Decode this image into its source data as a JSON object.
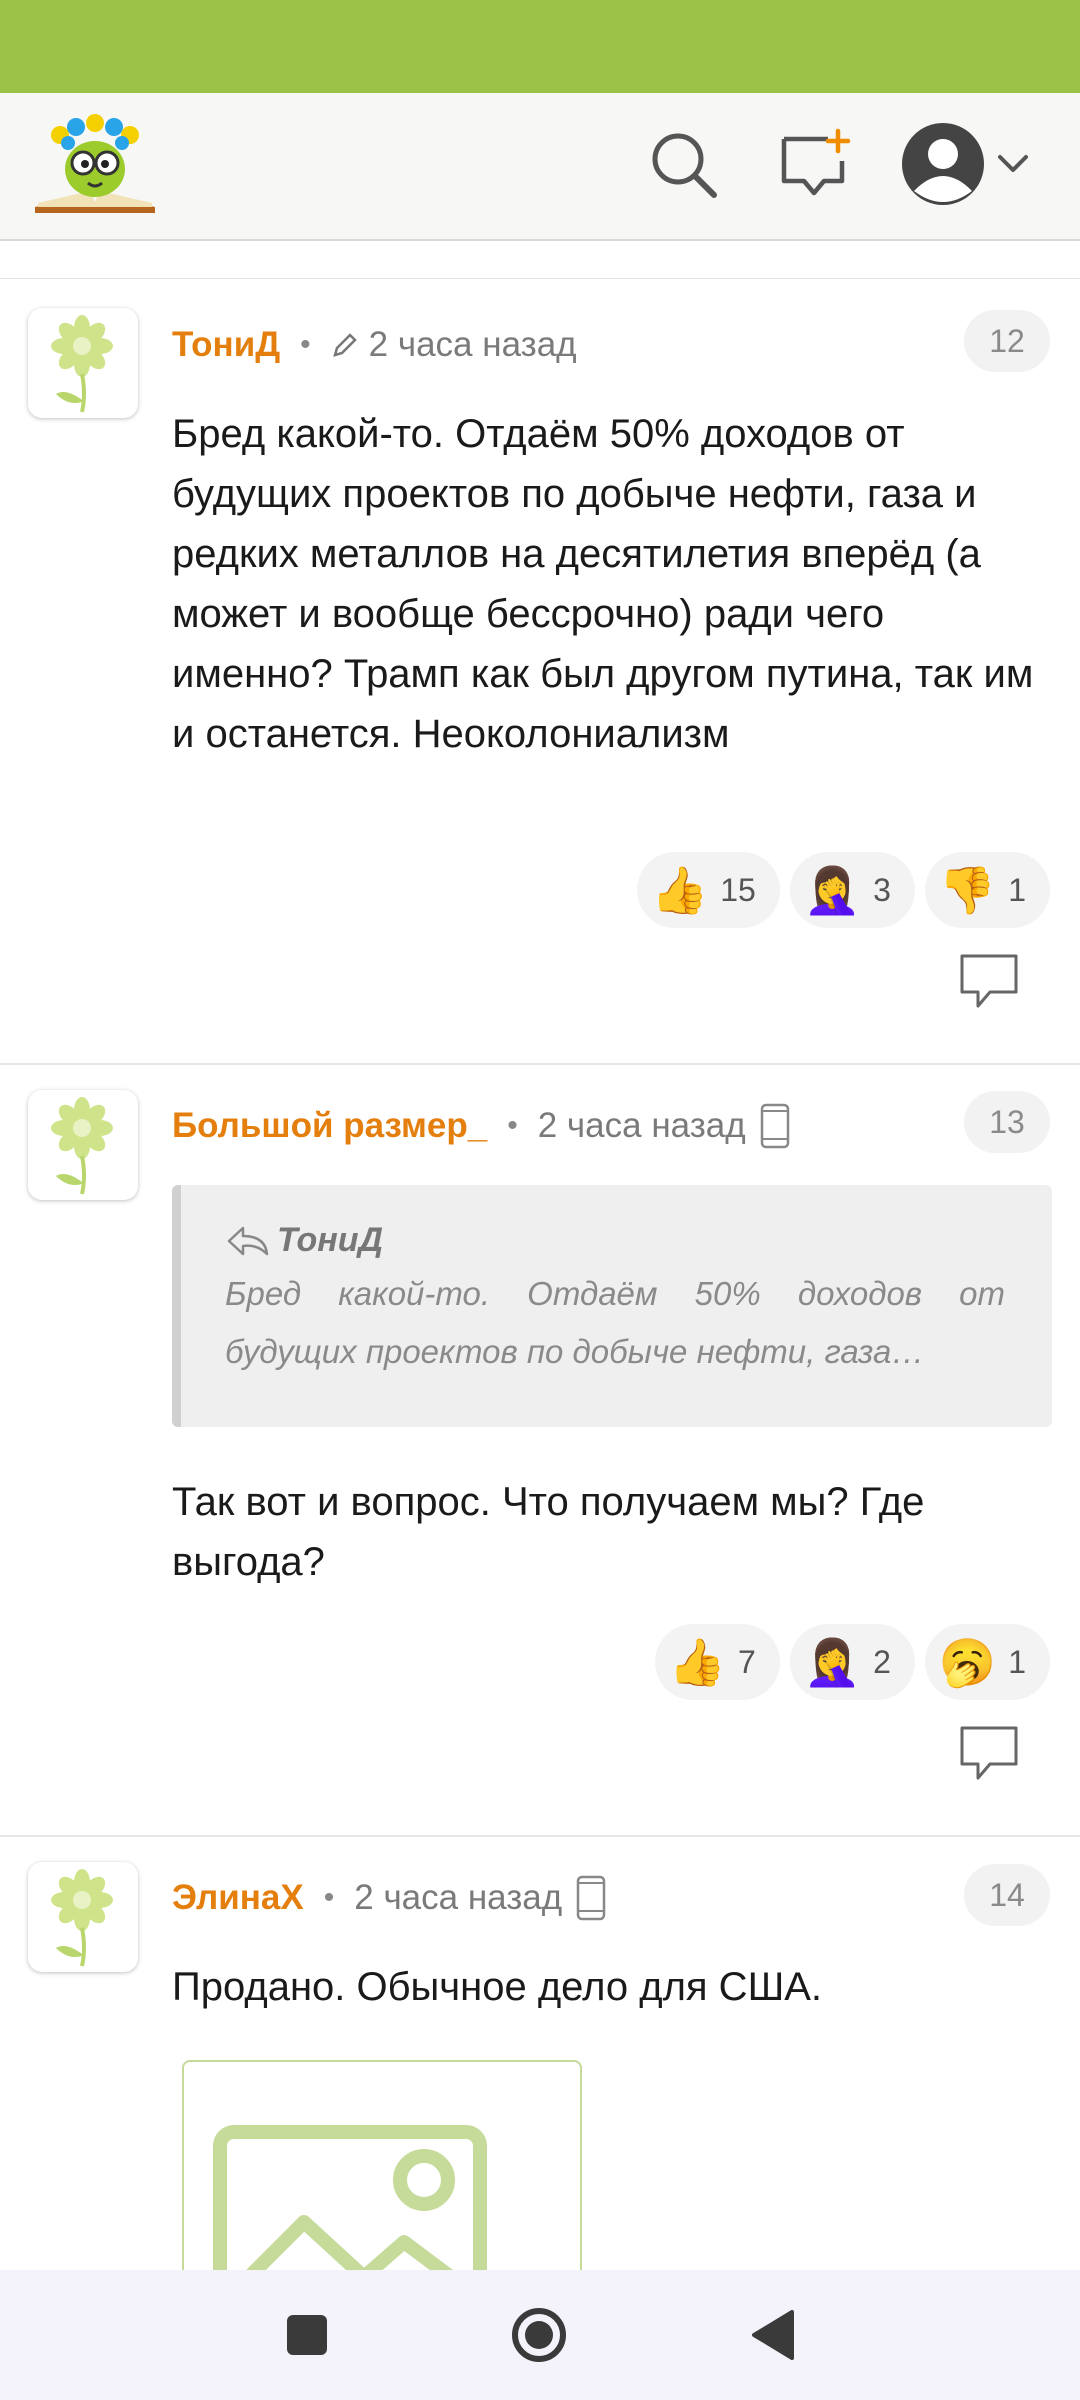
{
  "header": {
    "search_icon": "search-icon",
    "new_post_icon": "new-message-plus-icon",
    "profile_icon": "profile-avatar-icon",
    "menu_icon": "chevron-down-icon"
  },
  "colors": {
    "status_bar": "#9bc146",
    "author": "#e47f0e",
    "quote_bg": "#efefef"
  },
  "comments": [
    {
      "author": "ТониД",
      "time": "2 часа назад",
      "number": "12",
      "text": "Бред какой-то. Отдаём 50% доходов от будущих проектов по добыче нефти, газа и редких металлов на десятилетия вперёд (а может и вообще бессрочно) ради чего именно? Трамп как был другом путина, так им и останется. Неоколониализм",
      "reactions": [
        {
          "emoji": "👍",
          "count": "15"
        },
        {
          "emoji": "🤦‍♀️",
          "count": "3"
        },
        {
          "emoji": "👎",
          "count": "1"
        }
      ]
    },
    {
      "author": "Большой размер_",
      "time": "2 часа назад",
      "number": "13",
      "quote": {
        "author": "ТониД",
        "text": "Бред какой-то. Отдаём 50% доходов от будущих проектов по добыче нефти, газа…"
      },
      "text": "Так вот и вопрос. Что получаем мы? Где выгода?",
      "reactions": [
        {
          "emoji": "👍",
          "count": "7"
        },
        {
          "emoji": "🤦‍♀️",
          "count": "2"
        },
        {
          "emoji": "🥱",
          "count": "1"
        }
      ]
    },
    {
      "author": "ЭлинаХ",
      "time": "2 часа назад",
      "number": "14",
      "text": "Продано. Обычное дело для США."
    }
  ],
  "navbar": {
    "recents_icon": "square-recents-icon",
    "home_icon": "circle-home-icon",
    "back_icon": "triangle-back-icon"
  }
}
